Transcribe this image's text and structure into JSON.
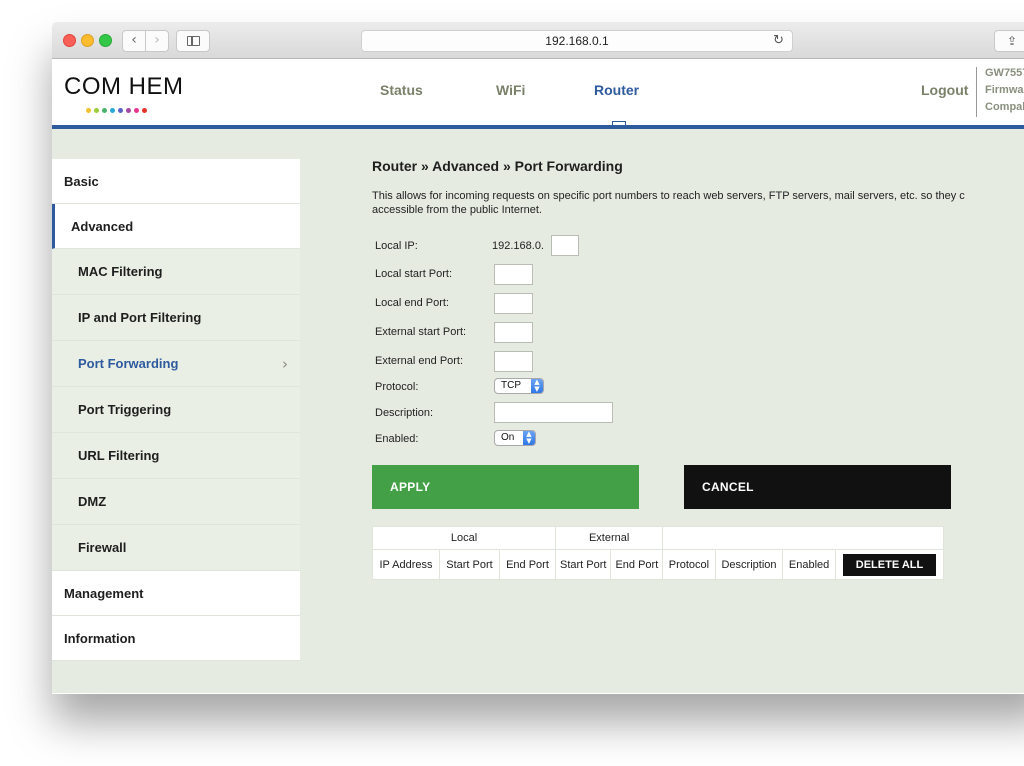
{
  "browser": {
    "url": "192.168.0.1",
    "back_glyph": "‹",
    "forward_glyph": "›",
    "reload_glyph": "↻",
    "share_glyph": "⇪"
  },
  "header": {
    "logo_text": "COM HEM",
    "logo_dot_colors": [
      "#f2c12e",
      "#9ccb3b",
      "#48b36d",
      "#2aa8d8",
      "#5b62c8",
      "#a349a4",
      "#e8368f",
      "#e5332a"
    ],
    "nav": [
      {
        "label": "Status",
        "active": false
      },
      {
        "label": "WiFi",
        "active": false
      },
      {
        "label": "Router",
        "active": true
      }
    ],
    "logout_label": "Logout",
    "device_info": [
      "GW7557",
      "Firmwa",
      "Compal"
    ]
  },
  "sidebar": {
    "items": [
      {
        "label": "Basic",
        "level": "top"
      },
      {
        "label": "Advanced",
        "level": "top",
        "open": true
      },
      {
        "label": "MAC Filtering",
        "level": "sub"
      },
      {
        "label": "IP and Port Filtering",
        "level": "sub"
      },
      {
        "label": "Port Forwarding",
        "level": "sub",
        "active": true
      },
      {
        "label": "Port Triggering",
        "level": "sub"
      },
      {
        "label": "URL Filtering",
        "level": "sub"
      },
      {
        "label": "DMZ",
        "level": "sub"
      },
      {
        "label": "Firewall",
        "level": "sub"
      },
      {
        "label": "Management",
        "level": "top"
      },
      {
        "label": "Information",
        "level": "top"
      }
    ],
    "chevron_glyph": "›"
  },
  "main": {
    "breadcrumb": "Router » Advanced » Port Forwarding",
    "description_line1": "This allows for incoming requests on specific port numbers to reach web servers, FTP servers, mail servers, etc. so they c",
    "description_line2": "accessible from the public Internet.",
    "form": {
      "local_ip_label": "Local IP:",
      "local_ip_prefix": "192.168.0.",
      "local_ip_value": "",
      "local_start_label": "Local start Port:",
      "local_start_value": "",
      "local_end_label": "Local end Port:",
      "local_end_value": "",
      "external_start_label": "External start Port:",
      "external_start_value": "",
      "external_end_label": "External end Port:",
      "external_end_value": "",
      "protocol_label": "Protocol:",
      "protocol_value": "TCP",
      "description_label": "Description:",
      "description_value": "",
      "enabled_label": "Enabled:",
      "enabled_value": "On"
    },
    "apply_label": "APPLY",
    "cancel_label": "CANCEL",
    "table": {
      "group_headers": [
        "Local",
        "External"
      ],
      "columns": [
        "IP Address",
        "Start Port",
        "End Port",
        "Start Port",
        "End Port",
        "Protocol",
        "Description",
        "Enabled"
      ],
      "delete_all_label": "DELETE ALL"
    }
  },
  "colors": {
    "accent_blue": "#2e5a9e",
    "apply_green": "#44a046",
    "cancel_black": "#111111",
    "page_bg": "#e6ebe2"
  }
}
